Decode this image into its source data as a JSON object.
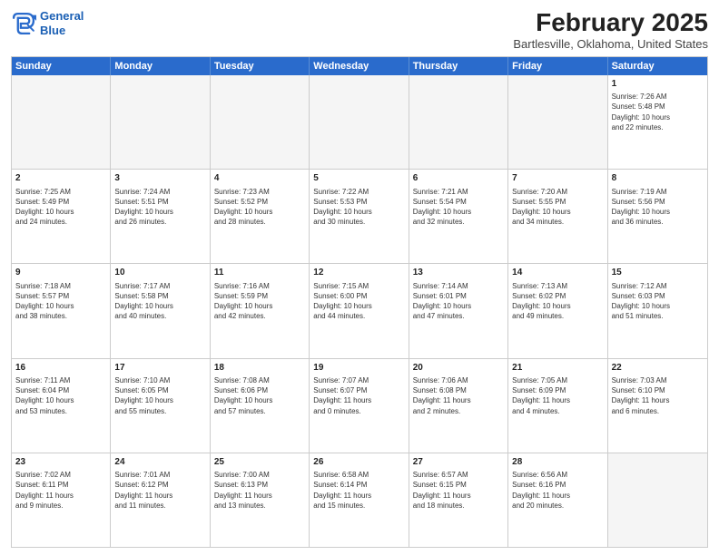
{
  "header": {
    "logo_line1": "General",
    "logo_line2": "Blue",
    "title": "February 2025",
    "location": "Bartlesville, Oklahoma, United States"
  },
  "weekdays": [
    "Sunday",
    "Monday",
    "Tuesday",
    "Wednesday",
    "Thursday",
    "Friday",
    "Saturday"
  ],
  "rows": [
    [
      {
        "day": "",
        "info": ""
      },
      {
        "day": "",
        "info": ""
      },
      {
        "day": "",
        "info": ""
      },
      {
        "day": "",
        "info": ""
      },
      {
        "day": "",
        "info": ""
      },
      {
        "day": "",
        "info": ""
      },
      {
        "day": "1",
        "info": "Sunrise: 7:26 AM\nSunset: 5:48 PM\nDaylight: 10 hours\nand 22 minutes."
      }
    ],
    [
      {
        "day": "2",
        "info": "Sunrise: 7:25 AM\nSunset: 5:49 PM\nDaylight: 10 hours\nand 24 minutes."
      },
      {
        "day": "3",
        "info": "Sunrise: 7:24 AM\nSunset: 5:51 PM\nDaylight: 10 hours\nand 26 minutes."
      },
      {
        "day": "4",
        "info": "Sunrise: 7:23 AM\nSunset: 5:52 PM\nDaylight: 10 hours\nand 28 minutes."
      },
      {
        "day": "5",
        "info": "Sunrise: 7:22 AM\nSunset: 5:53 PM\nDaylight: 10 hours\nand 30 minutes."
      },
      {
        "day": "6",
        "info": "Sunrise: 7:21 AM\nSunset: 5:54 PM\nDaylight: 10 hours\nand 32 minutes."
      },
      {
        "day": "7",
        "info": "Sunrise: 7:20 AM\nSunset: 5:55 PM\nDaylight: 10 hours\nand 34 minutes."
      },
      {
        "day": "8",
        "info": "Sunrise: 7:19 AM\nSunset: 5:56 PM\nDaylight: 10 hours\nand 36 minutes."
      }
    ],
    [
      {
        "day": "9",
        "info": "Sunrise: 7:18 AM\nSunset: 5:57 PM\nDaylight: 10 hours\nand 38 minutes."
      },
      {
        "day": "10",
        "info": "Sunrise: 7:17 AM\nSunset: 5:58 PM\nDaylight: 10 hours\nand 40 minutes."
      },
      {
        "day": "11",
        "info": "Sunrise: 7:16 AM\nSunset: 5:59 PM\nDaylight: 10 hours\nand 42 minutes."
      },
      {
        "day": "12",
        "info": "Sunrise: 7:15 AM\nSunset: 6:00 PM\nDaylight: 10 hours\nand 44 minutes."
      },
      {
        "day": "13",
        "info": "Sunrise: 7:14 AM\nSunset: 6:01 PM\nDaylight: 10 hours\nand 47 minutes."
      },
      {
        "day": "14",
        "info": "Sunrise: 7:13 AM\nSunset: 6:02 PM\nDaylight: 10 hours\nand 49 minutes."
      },
      {
        "day": "15",
        "info": "Sunrise: 7:12 AM\nSunset: 6:03 PM\nDaylight: 10 hours\nand 51 minutes."
      }
    ],
    [
      {
        "day": "16",
        "info": "Sunrise: 7:11 AM\nSunset: 6:04 PM\nDaylight: 10 hours\nand 53 minutes."
      },
      {
        "day": "17",
        "info": "Sunrise: 7:10 AM\nSunset: 6:05 PM\nDaylight: 10 hours\nand 55 minutes."
      },
      {
        "day": "18",
        "info": "Sunrise: 7:08 AM\nSunset: 6:06 PM\nDaylight: 10 hours\nand 57 minutes."
      },
      {
        "day": "19",
        "info": "Sunrise: 7:07 AM\nSunset: 6:07 PM\nDaylight: 11 hours\nand 0 minutes."
      },
      {
        "day": "20",
        "info": "Sunrise: 7:06 AM\nSunset: 6:08 PM\nDaylight: 11 hours\nand 2 minutes."
      },
      {
        "day": "21",
        "info": "Sunrise: 7:05 AM\nSunset: 6:09 PM\nDaylight: 11 hours\nand 4 minutes."
      },
      {
        "day": "22",
        "info": "Sunrise: 7:03 AM\nSunset: 6:10 PM\nDaylight: 11 hours\nand 6 minutes."
      }
    ],
    [
      {
        "day": "23",
        "info": "Sunrise: 7:02 AM\nSunset: 6:11 PM\nDaylight: 11 hours\nand 9 minutes."
      },
      {
        "day": "24",
        "info": "Sunrise: 7:01 AM\nSunset: 6:12 PM\nDaylight: 11 hours\nand 11 minutes."
      },
      {
        "day": "25",
        "info": "Sunrise: 7:00 AM\nSunset: 6:13 PM\nDaylight: 11 hours\nand 13 minutes."
      },
      {
        "day": "26",
        "info": "Sunrise: 6:58 AM\nSunset: 6:14 PM\nDaylight: 11 hours\nand 15 minutes."
      },
      {
        "day": "27",
        "info": "Sunrise: 6:57 AM\nSunset: 6:15 PM\nDaylight: 11 hours\nand 18 minutes."
      },
      {
        "day": "28",
        "info": "Sunrise: 6:56 AM\nSunset: 6:16 PM\nDaylight: 11 hours\nand 20 minutes."
      },
      {
        "day": "",
        "info": ""
      }
    ]
  ]
}
